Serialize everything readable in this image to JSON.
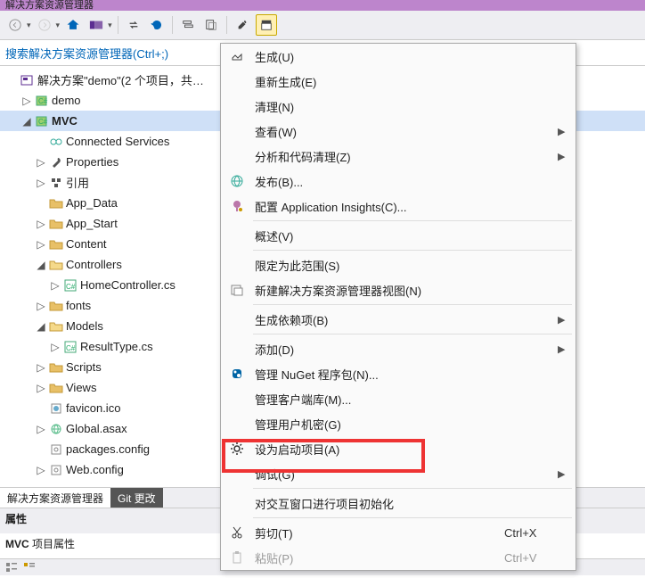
{
  "title": "解决方案资源管理器",
  "search": "搜索解决方案资源管理器(Ctrl+;)",
  "tree": {
    "solution": "解决方案\"demo\"(2 个项目，共…",
    "proj_demo": "demo",
    "proj_mvc": "MVC",
    "connected": "Connected Services",
    "properties": "Properties",
    "references": "引用",
    "appdata": "App_Data",
    "appstart": "App_Start",
    "content": "Content",
    "controllers": "Controllers",
    "homectrl": "HomeController.cs",
    "fonts": "fonts",
    "models": "Models",
    "resulttype": "ResultType.cs",
    "scripts": "Scripts",
    "views": "Views",
    "favicon": "favicon.ico",
    "globalasax": "Global.asax",
    "packages": "packages.config",
    "webconfig": "Web.config"
  },
  "tabs": {
    "t1": "解决方案资源管理器",
    "t2": "Git 更改"
  },
  "props": {
    "title": "属性",
    "line": "MVC 项目属性"
  },
  "menu": {
    "build": "生成(U)",
    "rebuild": "重新生成(E)",
    "clean": "清理(N)",
    "view": "查看(W)",
    "analyze": "分析和代码清理(Z)",
    "publish": "发布(B)...",
    "insights": "配置 Application Insights(C)...",
    "overview": "概述(V)",
    "scope": "限定为此范围(S)",
    "newview": "新建解决方案资源管理器视图(N)",
    "builddep": "生成依赖项(B)",
    "add": "添加(D)",
    "nuget": "管理 NuGet 程序包(N)...",
    "clientlib": "管理客户端库(M)...",
    "secrets": "管理用户机密(G)",
    "setstartup": "设为启动项目(A)",
    "debug": "调试(G)",
    "interactive": "对交互窗口进行项目初始化",
    "cut": "剪切(T)",
    "paste": "粘贴(P)",
    "sc_cut": "Ctrl+X",
    "sc_paste": "Ctrl+V"
  }
}
